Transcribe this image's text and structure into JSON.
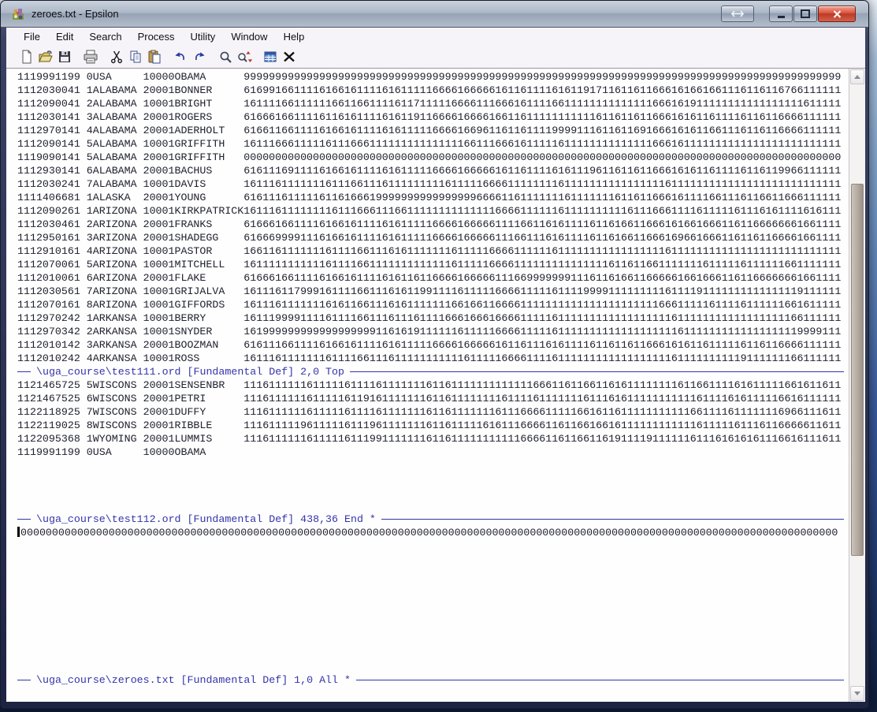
{
  "window": {
    "title": "zeroes.txt - Epsilon"
  },
  "titlebar": {
    "buttons": [
      {
        "name": "resize-toggle",
        "icon": "swap-arrows"
      },
      {
        "name": "minimize",
        "icon": "minimize-glyph"
      },
      {
        "name": "maximize",
        "icon": "maximize-glyph"
      },
      {
        "name": "close",
        "icon": "close-x"
      }
    ]
  },
  "menu": {
    "items": [
      "File",
      "Edit",
      "Search",
      "Process",
      "Utility",
      "Window",
      "Help"
    ]
  },
  "toolbar": {
    "buttons": [
      {
        "icon": "new-document"
      },
      {
        "icon": "open-file"
      },
      {
        "icon": "save"
      },
      {
        "icon": "print",
        "group_start": true
      },
      {
        "icon": "cut",
        "group_start": true
      },
      {
        "icon": "copy"
      },
      {
        "icon": "paste"
      },
      {
        "icon": "undo",
        "group_start": true
      },
      {
        "icon": "redo"
      },
      {
        "icon": "search",
        "group_start": true
      },
      {
        "icon": "query-replace"
      },
      {
        "icon": "dialog-list",
        "group_start": true
      },
      {
        "icon": "delete"
      }
    ]
  },
  "buffers": [
    {
      "modeline": "\\uga_course\\test111.ord [Fundamental Def] 2,0 Top",
      "blank_after": 0,
      "lines": [
        "1119991199 0USA     10000OBAMA      99999999999999999999999999999999999999999999999999999999999999999999999999999999999999999999999",
        "1112030041 1ALABAMA 20001BONNER     61699166111161661611116161111166661666661611611116161191711611611666161661661116116116766111111",
        "1112090041 2ALABAMA 10001BRIGHT     16111166111111661166111161171111166661116661611116611111111111111666161911111111111111111611111",
        "1112030141 3ALABAMA 20001ROGERS     61666166111161161611116161191166661666616611611111111111611611611666161611611116116116666111111",
        "1112970141 4ALABAMA 20001ADERHOLT   61661166111161661611116161111166661669611611611119999111611611691666161611661116116116666111111",
        "1112090141 5ALABAMA 10001GRIFFITH   16111666111116111666111111111111111661116661611111611111111111111666161111111111111111111111111",
        "1119090141 5ALABAMA 20001GRIFFITH   00000000000000000000000000000000000000000000000000000000000000000000000000000000000000000000000",
        "1112930141 6ALABAMA 20001BACHUS     61611169111161661611116161111166661666661611611116161119611611611666161611611116116119966111111",
        "1112030241 7ALABAMA 10001DAVIS      16111611111116111661116111111111611111666611111111611111111111111116111111111111111111111111111",
        "1111406681 1ALASKA  20001YOUNG      61611161111161161666199999999999999996666116111111161111111611611666161111661116116611666111111",
        "1112090261 1ARIZONA 10001KIRKPATRICK16111611111111611166611166111111111111116666111111611111111116111666111161111161116161111616111",
        "1112030461 2ARIZONA 20001FRANKS     61666166111161661611116161111166661666661111661161611116116166116661616616661161166666661661111",
        "1112950161 3ARIZONA 20001SHADEGG    61666999911161661611116161111166661666661116611161611116116166116661696616661161161166661661111",
        "1112910161 4ARIZONA 10001PASTOR     16611611111116111166111616111111161111166661111116111111111111111116111111111111111111111111111",
        "1112070061 5ARIZONA 10001MITCHELL   16111111111116111166111111111111161111166661111111111111116116116611111116111116111111661111111",
        "1112010061 6ARIZONA 20001FLAKE      61666166111161661611116161161166661666661116699999991116116166116666616616661161166666661661111",
        "1112030561 7ARIZONA 10001GRIJALVA   16111611799916111166111616119911116111116666111116111199991111111116111191111111111111119111111",
        "1112070161 8ARIZONA 10001GIFFORDS   16111611111116161166111616111111166166116666111111111111111111111166611111611116111111661611111",
        "1112970242 1ARKANSA 10001BERRY      16111999911116111166111611161111666166616666111116111111111111111111611111111111111111166111111",
        "1112970342 2ARKANSA 10001SNYDER     16199999999999999999911616191111116111116666111116111111111111111111161111111111111111119999111",
        "1112010142 3ARKANSA 20001BOOZMAN    61611166111161661611116161111166661666661611611161611116116116116661616116111116116116666111111",
        "1112010242 4ARKANSA 10001ROSS       16111611111116111166111611111111111611111666611116111111111111111111611111111119111111166111111"
      ]
    },
    {
      "modeline": "\\uga_course\\test112.ord [Fundamental Def] 438,36 End *",
      "blank_after": 4,
      "lines": [
        "1121465725 5WISCONS 20001SENSENBR   11161111116111116111161111111611611111111111116661161166116161111111161166111161611111661611611",
        "1121467525 6WISCONS 20001PETRI      11161111116111116119161111111611611111111611116111111161116161111111111161111616111116616111111",
        "1122118925 7WISCONS 20001DUFFY      11161111116111116111161111111611611111116111666611111661611611111111111661111611111116966111611",
        "1122119025 8WISCONS 20001RIBBLE     11161111196111116111961111111611611111616111666611611661661611111111111161111161116116666611611",
        "1122095368 1WYOMING 20001LUMMIS     11161111116111116111991111111611611111111111666611611661161911119111111611161616161116616111611",
        "1119991199 0USA     10000OBAMA"
      ]
    },
    {
      "modeline": "\\uga_course\\zeroes.txt [Fundamental Def] 1,0 All *",
      "blank_after": 10,
      "cursor_line": 0,
      "lines": [
        "0000000000000000000000000000000000000000000000000000000000000000000000000000000000000000000000000000000000000000000000000000000000"
      ]
    }
  ],
  "colors": {
    "modeline_blue": "#3434ac",
    "text": "#20222f",
    "close_red": "#c23a26",
    "titlebar_glass": "#aeb9c8"
  }
}
